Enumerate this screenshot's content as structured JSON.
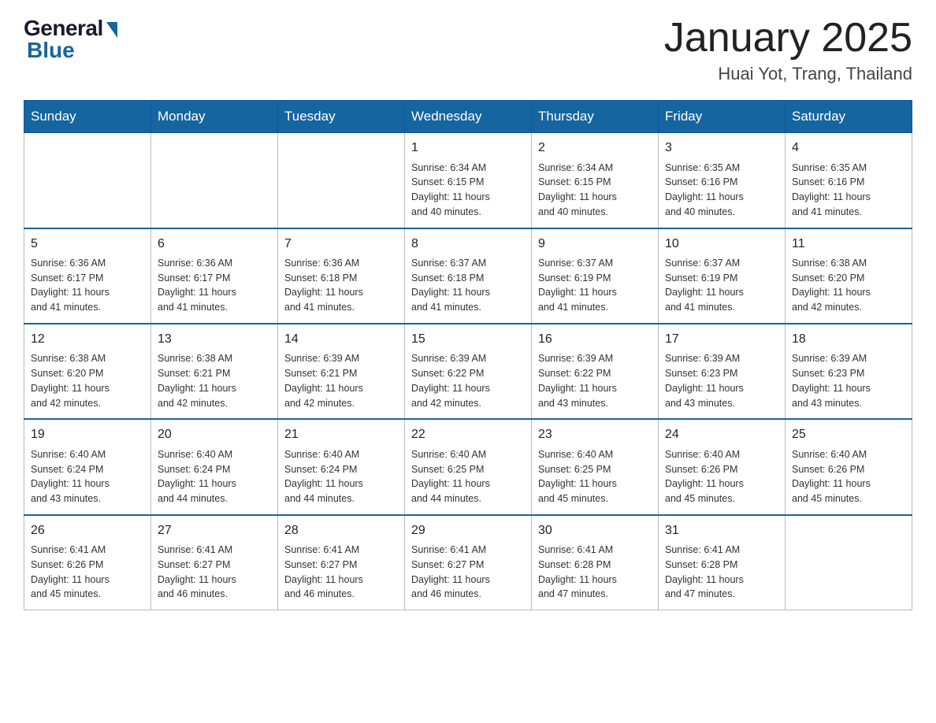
{
  "header": {
    "logo_general": "General",
    "logo_blue": "Blue",
    "month_title": "January 2025",
    "location": "Huai Yot, Trang, Thailand"
  },
  "weekdays": [
    "Sunday",
    "Monday",
    "Tuesday",
    "Wednesday",
    "Thursday",
    "Friday",
    "Saturday"
  ],
  "weeks": [
    [
      {
        "day": "",
        "info": ""
      },
      {
        "day": "",
        "info": ""
      },
      {
        "day": "",
        "info": ""
      },
      {
        "day": "1",
        "info": "Sunrise: 6:34 AM\nSunset: 6:15 PM\nDaylight: 11 hours\nand 40 minutes."
      },
      {
        "day": "2",
        "info": "Sunrise: 6:34 AM\nSunset: 6:15 PM\nDaylight: 11 hours\nand 40 minutes."
      },
      {
        "day": "3",
        "info": "Sunrise: 6:35 AM\nSunset: 6:16 PM\nDaylight: 11 hours\nand 40 minutes."
      },
      {
        "day": "4",
        "info": "Sunrise: 6:35 AM\nSunset: 6:16 PM\nDaylight: 11 hours\nand 41 minutes."
      }
    ],
    [
      {
        "day": "5",
        "info": "Sunrise: 6:36 AM\nSunset: 6:17 PM\nDaylight: 11 hours\nand 41 minutes."
      },
      {
        "day": "6",
        "info": "Sunrise: 6:36 AM\nSunset: 6:17 PM\nDaylight: 11 hours\nand 41 minutes."
      },
      {
        "day": "7",
        "info": "Sunrise: 6:36 AM\nSunset: 6:18 PM\nDaylight: 11 hours\nand 41 minutes."
      },
      {
        "day": "8",
        "info": "Sunrise: 6:37 AM\nSunset: 6:18 PM\nDaylight: 11 hours\nand 41 minutes."
      },
      {
        "day": "9",
        "info": "Sunrise: 6:37 AM\nSunset: 6:19 PM\nDaylight: 11 hours\nand 41 minutes."
      },
      {
        "day": "10",
        "info": "Sunrise: 6:37 AM\nSunset: 6:19 PM\nDaylight: 11 hours\nand 41 minutes."
      },
      {
        "day": "11",
        "info": "Sunrise: 6:38 AM\nSunset: 6:20 PM\nDaylight: 11 hours\nand 42 minutes."
      }
    ],
    [
      {
        "day": "12",
        "info": "Sunrise: 6:38 AM\nSunset: 6:20 PM\nDaylight: 11 hours\nand 42 minutes."
      },
      {
        "day": "13",
        "info": "Sunrise: 6:38 AM\nSunset: 6:21 PM\nDaylight: 11 hours\nand 42 minutes."
      },
      {
        "day": "14",
        "info": "Sunrise: 6:39 AM\nSunset: 6:21 PM\nDaylight: 11 hours\nand 42 minutes."
      },
      {
        "day": "15",
        "info": "Sunrise: 6:39 AM\nSunset: 6:22 PM\nDaylight: 11 hours\nand 42 minutes."
      },
      {
        "day": "16",
        "info": "Sunrise: 6:39 AM\nSunset: 6:22 PM\nDaylight: 11 hours\nand 43 minutes."
      },
      {
        "day": "17",
        "info": "Sunrise: 6:39 AM\nSunset: 6:23 PM\nDaylight: 11 hours\nand 43 minutes."
      },
      {
        "day": "18",
        "info": "Sunrise: 6:39 AM\nSunset: 6:23 PM\nDaylight: 11 hours\nand 43 minutes."
      }
    ],
    [
      {
        "day": "19",
        "info": "Sunrise: 6:40 AM\nSunset: 6:24 PM\nDaylight: 11 hours\nand 43 minutes."
      },
      {
        "day": "20",
        "info": "Sunrise: 6:40 AM\nSunset: 6:24 PM\nDaylight: 11 hours\nand 44 minutes."
      },
      {
        "day": "21",
        "info": "Sunrise: 6:40 AM\nSunset: 6:24 PM\nDaylight: 11 hours\nand 44 minutes."
      },
      {
        "day": "22",
        "info": "Sunrise: 6:40 AM\nSunset: 6:25 PM\nDaylight: 11 hours\nand 44 minutes."
      },
      {
        "day": "23",
        "info": "Sunrise: 6:40 AM\nSunset: 6:25 PM\nDaylight: 11 hours\nand 45 minutes."
      },
      {
        "day": "24",
        "info": "Sunrise: 6:40 AM\nSunset: 6:26 PM\nDaylight: 11 hours\nand 45 minutes."
      },
      {
        "day": "25",
        "info": "Sunrise: 6:40 AM\nSunset: 6:26 PM\nDaylight: 11 hours\nand 45 minutes."
      }
    ],
    [
      {
        "day": "26",
        "info": "Sunrise: 6:41 AM\nSunset: 6:26 PM\nDaylight: 11 hours\nand 45 minutes."
      },
      {
        "day": "27",
        "info": "Sunrise: 6:41 AM\nSunset: 6:27 PM\nDaylight: 11 hours\nand 46 minutes."
      },
      {
        "day": "28",
        "info": "Sunrise: 6:41 AM\nSunset: 6:27 PM\nDaylight: 11 hours\nand 46 minutes."
      },
      {
        "day": "29",
        "info": "Sunrise: 6:41 AM\nSunset: 6:27 PM\nDaylight: 11 hours\nand 46 minutes."
      },
      {
        "day": "30",
        "info": "Sunrise: 6:41 AM\nSunset: 6:28 PM\nDaylight: 11 hours\nand 47 minutes."
      },
      {
        "day": "31",
        "info": "Sunrise: 6:41 AM\nSunset: 6:28 PM\nDaylight: 11 hours\nand 47 minutes."
      },
      {
        "day": "",
        "info": ""
      }
    ]
  ]
}
